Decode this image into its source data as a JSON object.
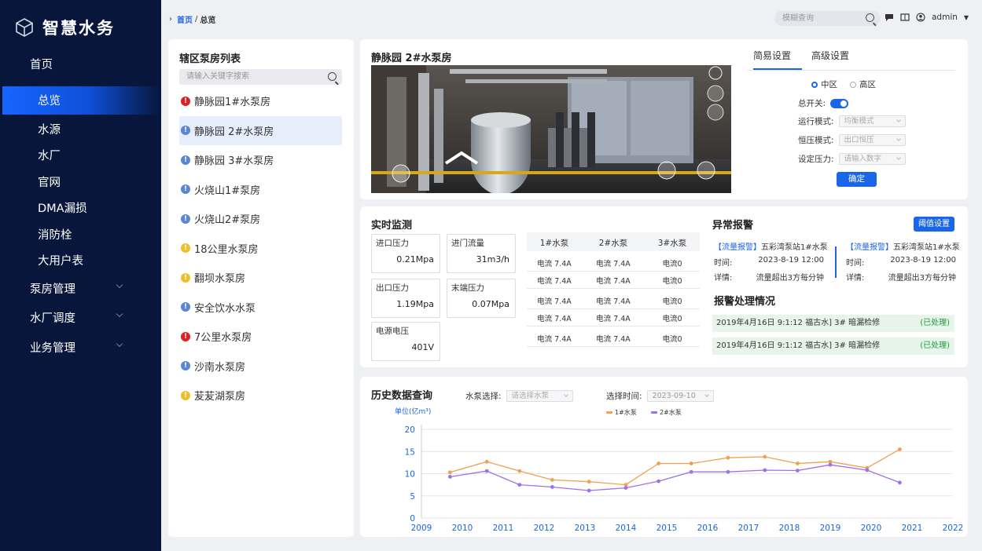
{
  "app": {
    "title": "智慧水务"
  },
  "nav": [
    {
      "label": "首页",
      "level": 1,
      "active": false,
      "caret": false
    },
    {
      "label": "总览",
      "level": 2,
      "active": true,
      "caret": false
    },
    {
      "label": "水源",
      "level": 2,
      "active": false,
      "caret": false
    },
    {
      "label": "水厂",
      "level": 2,
      "active": false,
      "caret": false
    },
    {
      "label": "官网",
      "level": 2,
      "active": false,
      "caret": false
    },
    {
      "label": "DMA漏损",
      "level": 2,
      "active": false,
      "caret": false
    },
    {
      "label": "消防栓",
      "level": 2,
      "active": false,
      "caret": false
    },
    {
      "label": "大用户表",
      "level": 2,
      "active": false,
      "caret": false
    },
    {
      "label": "泵房管理",
      "level": 1,
      "active": false,
      "caret": true
    },
    {
      "label": "水厂调度",
      "level": 1,
      "active": false,
      "caret": true
    },
    {
      "label": "业务管理",
      "level": 1,
      "active": false,
      "caret": true
    }
  ],
  "breadcrumb": {
    "home": "首页",
    "sep": "/",
    "current": "总览"
  },
  "top": {
    "search_placeholder": "模糊查询",
    "user": "admin"
  },
  "station_list": {
    "title": "辖区泵房列表",
    "search_placeholder": "请输入关键字搜索",
    "items": [
      {
        "name": "静脉园1#水泵房",
        "status": "red",
        "selected": false
      },
      {
        "name": "静脉园 2#水泵房",
        "status": "blue",
        "selected": true
      },
      {
        "name": "静脉园 3#水泵房",
        "status": "blue",
        "selected": false
      },
      {
        "name": "火烧山1#泵房",
        "status": "blue",
        "selected": false
      },
      {
        "name": "火烧山2#泵房",
        "status": "blue",
        "selected": false
      },
      {
        "name": "18公里水泵房",
        "status": "yellow",
        "selected": false
      },
      {
        "name": "翻坝水泵房",
        "status": "yellow",
        "selected": false
      },
      {
        "name": "安全饮水水泵",
        "status": "blue",
        "selected": false
      },
      {
        "name": "7公里水泵房",
        "status": "red",
        "selected": false
      },
      {
        "name": "沙南水泵房",
        "status": "blue",
        "selected": false
      },
      {
        "name": "苃苃湖泵房",
        "status": "yellow",
        "selected": false
      }
    ]
  },
  "video": {
    "title": "静脉园 2#水泵房"
  },
  "settings": {
    "tabs": [
      "简易设置",
      "高级设置"
    ],
    "zone_options": [
      "中区",
      "高区"
    ],
    "switch_label": "总开关:",
    "run_mode_label": "运行模式:",
    "run_mode_value": "均衡模式",
    "pressure_mode_label": "恒压模式:",
    "pressure_mode_value": "出口恒压",
    "set_pressure_label": "设定压力:",
    "set_pressure_placeholder": "请输入数字",
    "confirm": "确定"
  },
  "monitor": {
    "title": "实时监测",
    "boxes": [
      {
        "label": "进口压力",
        "value": "0.21Mpa"
      },
      {
        "label": "进门流量",
        "value": "31m3/h"
      },
      {
        "label": "出口压力",
        "value": "1.19Mpa"
      },
      {
        "label": "末端压力",
        "value": "0.07Mpa"
      },
      {
        "label": "电源电压",
        "value": "401V"
      }
    ],
    "pump_headers": [
      "1#水泵",
      "2#水泵",
      "3#水泵"
    ],
    "pump_rows": [
      [
        "电流 7.4A",
        "电流 7.4A",
        "电流0"
      ],
      [
        "电流 7.4A",
        "电流 7.4A",
        "电流0"
      ],
      [
        "电流 7.4A",
        "电流 7.4A",
        "电流0"
      ],
      [
        "电流 7.4A",
        "电流 7.4A",
        "电流0"
      ],
      [
        "电流 7.4A",
        "电流 7.4A",
        "电流0"
      ]
    ]
  },
  "alarm": {
    "title": "异常报警",
    "threshold_button": "阈值设置",
    "cards": [
      {
        "tag": "【流量报警】",
        "station": "五彩湾泵站1#水泵",
        "time_label": "时间:",
        "time": "2023-8-19 12:00",
        "detail_label": "详情:",
        "detail": "流量超出3方每分钟"
      },
      {
        "tag": "【流量报警】",
        "station": "五彩湾泵站1#水泵",
        "time_label": "时间:",
        "time": "2023-8-19 12:00",
        "detail_label": "详情:",
        "detail": "流量超出3方每分钟"
      }
    ],
    "handle_title": "报警处理情况",
    "handle_rows": [
      {
        "text": "2019年4月16日 9:1:12 福古水] 3# 暗漏检修",
        "status": "(已处理)"
      },
      {
        "text": "2019年4月16日 9:1:12 福古水] 3# 暗漏检修",
        "status": "(已处理)"
      }
    ]
  },
  "history": {
    "title": "历史数据查询",
    "pump_label": "水泵选择:",
    "pump_placeholder": "请选择水泵",
    "time_label": "选择时间:",
    "time_value": "2023-09-10"
  },
  "chart_data": {
    "type": "line",
    "ylabel": "单位(亿m³)",
    "ylim": [
      0,
      20
    ],
    "yticks": [
      0,
      5,
      10,
      15,
      20
    ],
    "xticks": [
      "2009",
      "2010",
      "2011",
      "2012",
      "2013",
      "2014",
      "2015",
      "2016",
      "2017",
      "2018",
      "2019",
      "2020",
      "2021",
      "2022"
    ],
    "legend_position": "top-center",
    "grid": true,
    "series": [
      {
        "name": "1#水泵",
        "color": "#f0a050",
        "x": [
          2009.7,
          2010.6,
          2011.4,
          2012.2,
          2013.1,
          2014.0,
          2014.8,
          2015.6,
          2016.5,
          2017.4,
          2018.2,
          2019.0,
          2019.9,
          2020.7
        ],
        "values": [
          10.3,
          12.7,
          10.6,
          8.6,
          8.2,
          7.5,
          12.3,
          12.3,
          13.6,
          13.8,
          12.3,
          12.7,
          11.3,
          15.5
        ]
      },
      {
        "name": "2#水泵",
        "color": "#a070e8",
        "x": [
          2009.7,
          2010.6,
          2011.4,
          2012.2,
          2013.1,
          2014.0,
          2014.8,
          2015.6,
          2016.5,
          2017.4,
          2018.2,
          2019.0,
          2019.9,
          2020.7
        ],
        "values": [
          9.3,
          10.6,
          7.5,
          7.0,
          6.2,
          6.8,
          8.3,
          10.4,
          10.4,
          10.8,
          10.7,
          12.0,
          10.8,
          8.0
        ]
      }
    ]
  }
}
